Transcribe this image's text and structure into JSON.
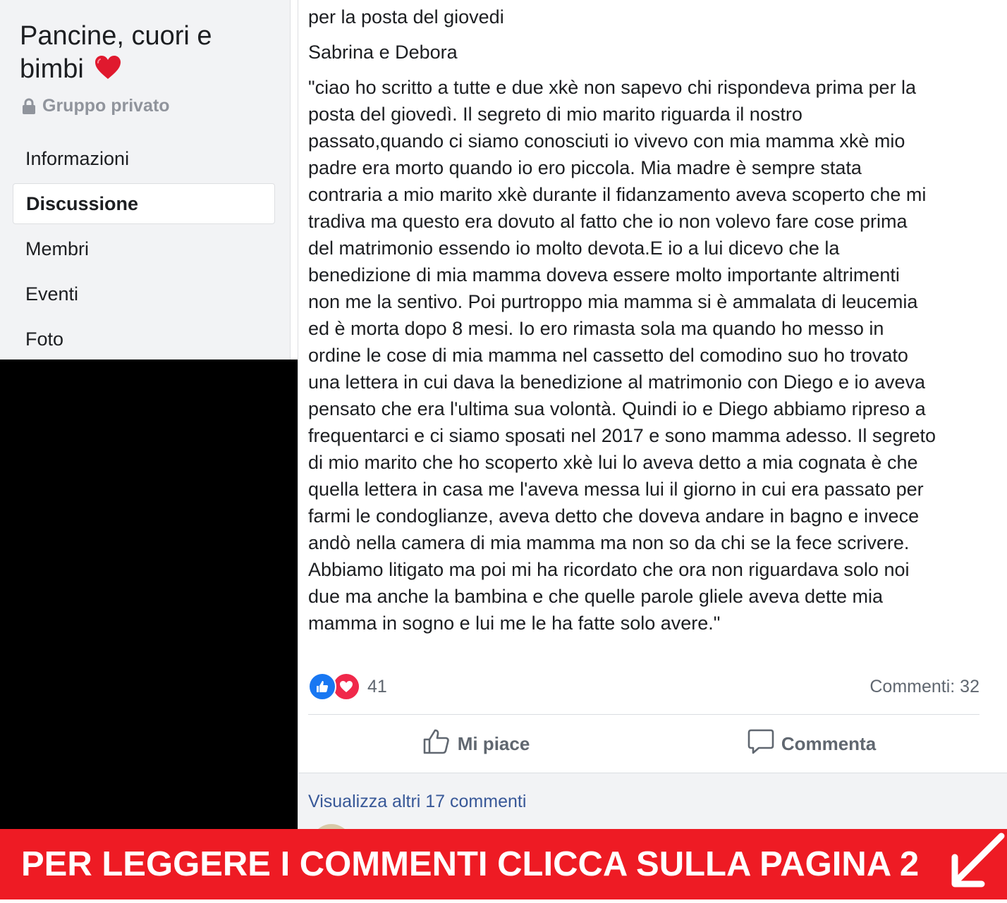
{
  "sidebar": {
    "group_name": "Pancine, cuori e bimbi",
    "privacy_label": "Gruppo privato",
    "nav": [
      {
        "label": "Informazioni",
        "active": false
      },
      {
        "label": "Discussione",
        "active": true
      },
      {
        "label": "Membri",
        "active": false
      },
      {
        "label": "Eventi",
        "active": false
      },
      {
        "label": "Foto",
        "active": false
      }
    ]
  },
  "post": {
    "line1": "per la posta del giovedi",
    "line2": "Sabrina e Debora",
    "text": "\"ciao ho scritto a tutte e due xkè non sapevo chi rispondeva prima per la\nposta del giovedì. Il segreto di mio marito riguarda il nostro\npassato,quando ci siamo conosciuti io vivevo con mia mamma xkè mio\npadre era morto quando io ero piccola. Mia madre è sempre stata\ncontraria a mio marito xkè durante il fidanzamento aveva scoperto che mi\ntradiva ma questo era dovuto al fatto che io non volevo fare cose prima\ndel matrimonio essendo io molto devota.E io a lui dicevo che la\nbenedizione di mia mamma doveva essere molto importante altrimenti\nnon me la sentivo. Poi purtroppo mia mamma si è ammalata di leucemia\ned è morta dopo 8 mesi. Io ero rimasta sola ma quando ho messo in\nordine le cose di mia mamma nel cassetto del comodino suo ho trovato\nuna lettera in cui dava la benedizione al matrimonio con Diego e io aveva\npensato che era l'ultima sua volontà. Quindi io e Diego abbiamo ripreso a\nfrequentarci e ci siamo sposati nel 2017 e sono mamma adesso. Il segreto\ndi mio marito che ho scoperto xkè lui lo aveva detto a mia cognata è che\nquella lettera in casa me l'aveva messa lui il giorno in cui era passato per\nfarmi le condoglianze, aveva detto che doveva andare in bagno e invece\nandò nella camera di mia mamma ma non so da chi se la fece scrivere.\nAbbiamo litigato ma poi mi ha ricordato che ora non riguardava solo noi\ndue ma anche la bambina e che quelle parole gliele aveva dette mia\nmamma in sogno e lui me le ha fatte solo avere.\"",
    "reaction_count": "41",
    "comments_count": "Commenti: 32",
    "like_label": "Mi piace",
    "comment_label": "Commenta",
    "more_comments": "Visualizza altri 17 commenti"
  },
  "banner": {
    "text": "PER LEGGERE I COMMENTI CLICCA SULLA PAGINA 2"
  },
  "colors": {
    "banner_red": "#ee1b24",
    "like_blue": "#1877f2",
    "love_red": "#f0284a",
    "link_blue": "#385898"
  },
  "icons": [
    "heart-emoji-icon",
    "lock-icon",
    "like-reaction-icon",
    "love-reaction-icon",
    "thumbs-up-icon",
    "comment-bubble-icon",
    "arrow-down-left-icon"
  ]
}
